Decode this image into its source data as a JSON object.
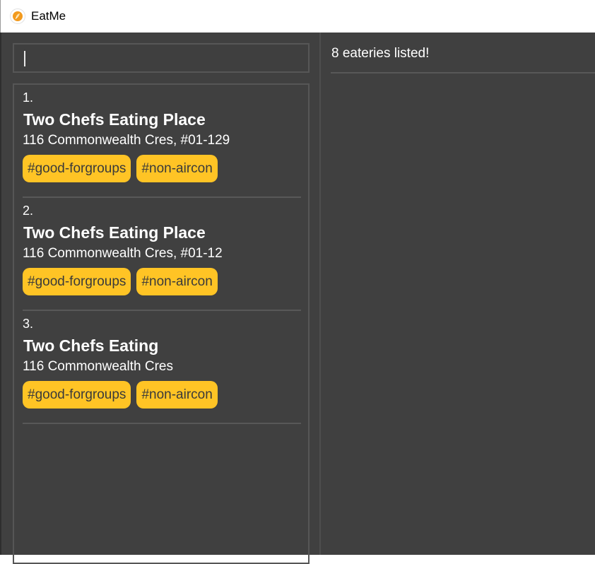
{
  "window": {
    "title": "EatMe",
    "icon": "eatme-app-icon",
    "accent_color": "#f29a1e"
  },
  "command_box": {
    "value": ""
  },
  "result_display": {
    "text": "8 eateries listed!"
  },
  "eateries": [
    {
      "index": "1.",
      "name": "Two Chefs Eating Place",
      "address": "116 Commonwealth Cres, #01-129",
      "tags": [
        "#good-forgroups",
        "#non-aircon"
      ]
    },
    {
      "index": "2.",
      "name": "Two Chefs Eating Place",
      "address": "116 Commonwealth Cres, #01-12",
      "tags": [
        "#good-forgroups",
        "#non-aircon"
      ]
    },
    {
      "index": "3.",
      "name": "Two Chefs Eating",
      "address": "116 Commonwealth Cres",
      "tags": [
        "#good-forgroups",
        "#non-aircon"
      ]
    }
  ],
  "colors": {
    "background": "#404040",
    "tag_background": "#ffc425",
    "tag_text": "#3a3a3a",
    "text": "#ffffff"
  }
}
